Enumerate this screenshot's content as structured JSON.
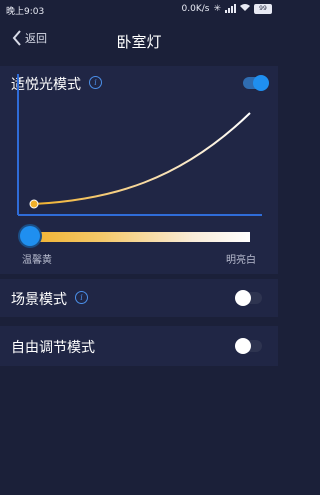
{
  "status_bar": {
    "time": "晚上9:03",
    "speed": "0.0K/s",
    "battery": "99"
  },
  "header": {
    "back_label": "返回",
    "title": "卧室灯"
  },
  "circadian": {
    "label": "适悦光模式",
    "enabled": true,
    "slider": {
      "min_label": "温馨黄",
      "max_label": "明亮白",
      "value": 0
    }
  },
  "scene": {
    "label": "场景模式",
    "enabled": false
  },
  "free": {
    "label": "自由调节模式",
    "enabled": false
  },
  "colors": {
    "background": "#1b2039",
    "panel": "#202645",
    "accent": "#1f8ff0",
    "warm": "#f0b02a"
  }
}
